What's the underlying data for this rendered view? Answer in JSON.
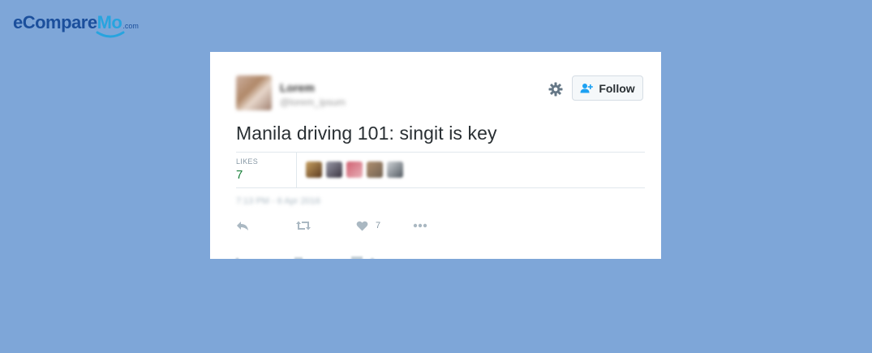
{
  "logo": {
    "main": "eCompare",
    "accent": "Mo",
    "suffix": ".com"
  },
  "tweet": {
    "user_name": "Lorem",
    "user_handle": "@lorem_ipsum",
    "follow_label": "Follow",
    "text": "Manila driving 101: singit is key",
    "likes_label": "LIKES",
    "likes_count": "7",
    "timestamp": "7:13 PM - 6 Apr 2016",
    "action_like_count": "7"
  },
  "colors": {
    "background": "#7ea6d8",
    "logo_blue": "#1b4f9c",
    "logo_accent": "#27a4df",
    "likes_green": "#19803a",
    "follow_icon": "#1da1f2"
  },
  "icons": {
    "settings": "gear-icon",
    "follow": "follow-user-icon",
    "reply": "reply-icon",
    "retweet": "retweet-icon",
    "like": "heart-icon",
    "more": "more-dots-icon"
  }
}
